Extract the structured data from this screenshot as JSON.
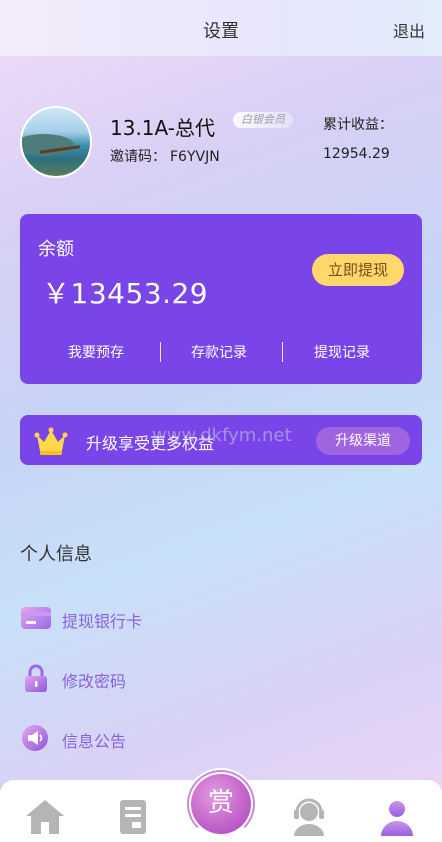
{
  "header": {
    "title": "设置",
    "exit_label": "退出"
  },
  "profile": {
    "avatar_icon": "avatar-landscape-photo",
    "nickname": "13.1A-总代",
    "vip_badge": "白银会员",
    "invite_label": "邀请码：",
    "invite_code": "F6YVJN",
    "earnings_label": "累计收益：",
    "earnings_value": "12954.29"
  },
  "balance_card": {
    "label": "余额",
    "amount": "￥13453.29",
    "withdraw_button": "立即提现",
    "links": [
      "我要预存",
      "存款记录",
      "提现记录"
    ],
    "background_color": "#7a45e8",
    "button_color": "#ffd76a"
  },
  "upgrade": {
    "icon": "crown-icon",
    "text": "升级享受更多权益",
    "button": "升级渠道"
  },
  "watermark": "www.dkfym.net",
  "personal_info": {
    "title": "个人信息",
    "items": [
      {
        "label": "提现银行卡",
        "icon": "bank-card-icon"
      },
      {
        "label": "修改密码",
        "icon": "lock-icon"
      },
      {
        "label": "信息公告",
        "icon": "megaphone-icon"
      }
    ]
  },
  "tabbar": {
    "tabs": [
      {
        "icon": "home-icon"
      },
      {
        "icon": "document-icon"
      },
      {
        "icon": "reward-icon",
        "label": "赏"
      },
      {
        "icon": "customer-service-icon"
      },
      {
        "icon": "profile-icon"
      }
    ],
    "active_color": "#a36bdf"
  }
}
